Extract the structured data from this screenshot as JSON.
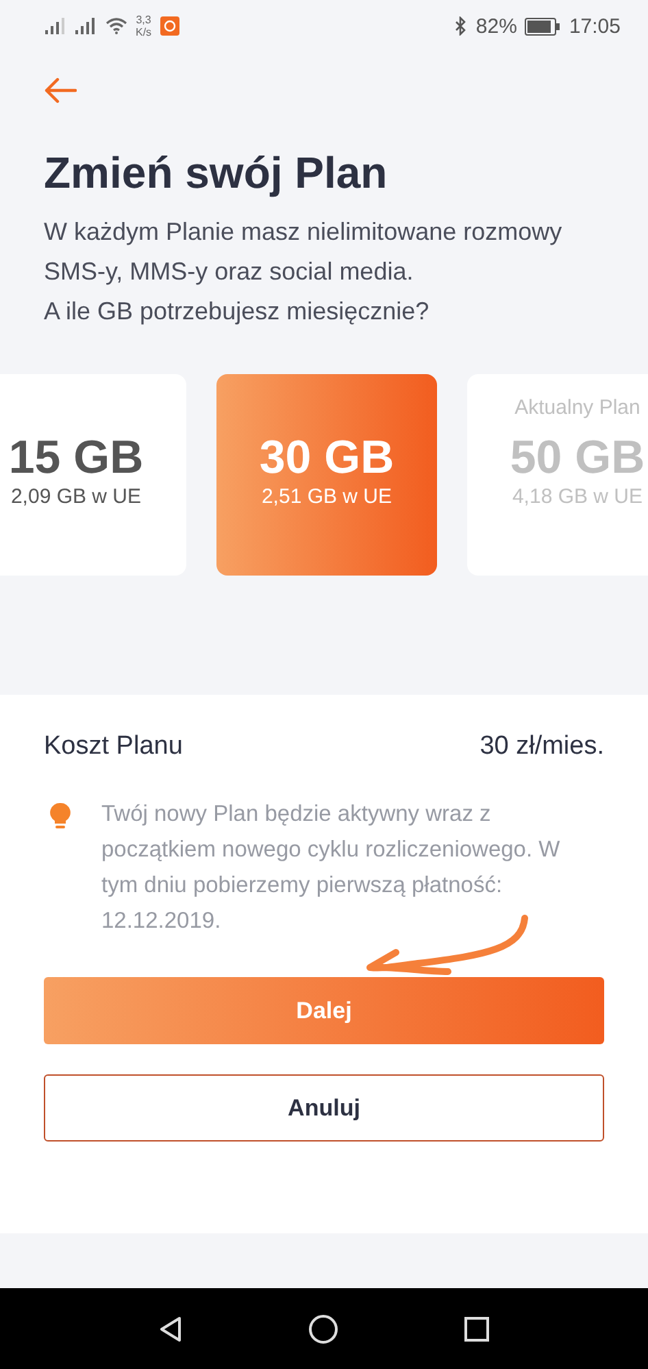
{
  "status_bar": {
    "speed": "3,3",
    "speed_unit": "K/s",
    "battery": "82%",
    "time": "17:05"
  },
  "title": "Zmień swój Plan",
  "subtitle": [
    "W każdym Planie masz nielimitowane rozmowy SMS-y, MMS-y oraz social media.",
    "A ile GB potrzebujesz miesięcznie?"
  ],
  "plans": [
    {
      "amount": "15 GB",
      "eu": "2,09 GB w UE",
      "selected": false,
      "current": false
    },
    {
      "amount": "30 GB",
      "eu": "2,51 GB w UE",
      "selected": true,
      "current": false
    },
    {
      "amount": "50 GB",
      "eu": "4,18 GB w UE",
      "selected": false,
      "current": true,
      "label": "Aktualny Plan"
    }
  ],
  "cost": {
    "label": "Koszt Planu",
    "value": "30 zł/mies."
  },
  "info": "Twój nowy Plan będzie aktywny wraz z początkiem nowego cyklu rozliczeniowego. W tym dniu pobierzemy pierwszą płatność: 12.12.2019.",
  "buttons": {
    "primary": "Dalej",
    "secondary": "Anuluj"
  }
}
